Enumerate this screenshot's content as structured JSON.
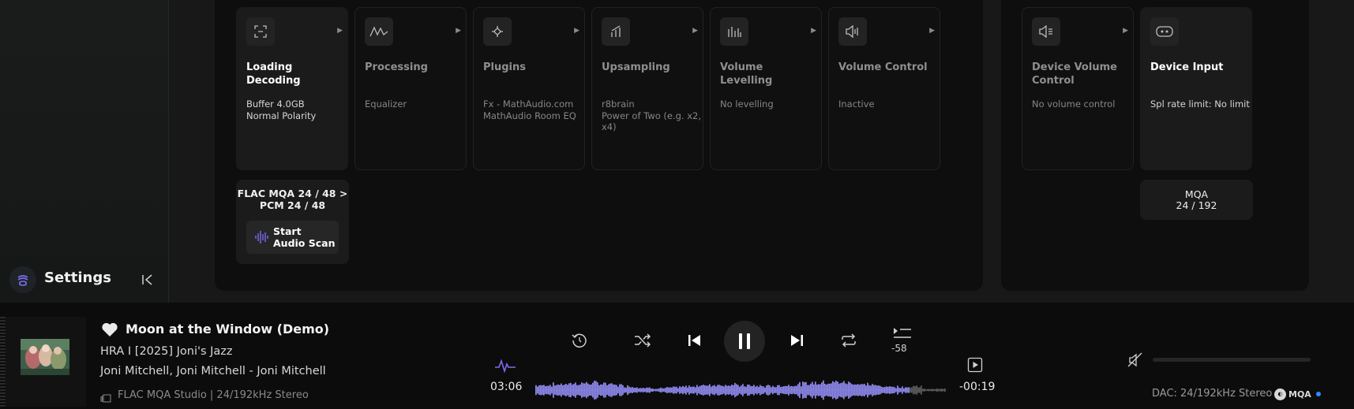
{
  "sidebar": {
    "settings_label": "Settings"
  },
  "pipeline": {
    "cards": [
      {
        "title": "Loading Decoding",
        "details": [
          "Buffer 4.0GB",
          "Normal Polarity"
        ],
        "icon": "scan-icon",
        "active": true
      },
      {
        "title": "Processing",
        "details": [
          "Equalizer"
        ],
        "icon": "waveform-processing-icon",
        "active": false
      },
      {
        "title": "Plugins",
        "details": [
          "Fx - MathAudio.com",
          "MathAudio Room EQ"
        ],
        "icon": "plugin-icon",
        "active": false
      },
      {
        "title": "Upsampling",
        "details": [
          "r8brain",
          "Power of Two (e.g. x2, x4)"
        ],
        "icon": "upsampling-icon",
        "active": false
      },
      {
        "title": "Volume Levelling",
        "details": [
          "No levelling"
        ],
        "icon": "levels-icon",
        "active": false
      },
      {
        "title": "Volume Control",
        "details": [
          "Inactive"
        ],
        "icon": "speaker-icon",
        "active": false
      }
    ],
    "format": "FLAC MQA 24 / 48 > PCM 24 / 48",
    "scan_button": "Start Audio Scan"
  },
  "device": {
    "cards": [
      {
        "title": "Device Volume Control",
        "details": [
          "No volume control"
        ],
        "icon": "device-volume-icon",
        "active": false
      },
      {
        "title": "Device Input",
        "details": [
          "Spl rate limit: No limit"
        ],
        "icon": "device-input-icon",
        "active": true
      }
    ],
    "output_format": "MQA\n24 / 192"
  },
  "player": {
    "track_title": "Moon at the Window (Demo)",
    "album": "HRA I [2025] Joni's Jazz",
    "artists": "Joni Mitchell, Joni Mitchell - Joni Mitchell",
    "format": "FLAC MQA Studio | 24/192kHz Stereo",
    "elapsed": "03:06",
    "remaining": "-00:19",
    "skip_seconds": "-58",
    "progress": 0.91,
    "dac": "DAC: 24/192kHz Stereo",
    "mqa_badge": "MQA",
    "colors": {
      "waveform_played": "#8b86e8",
      "waveform_unplayed": "#5a5a5a",
      "accent": "#7b6cf0"
    }
  }
}
